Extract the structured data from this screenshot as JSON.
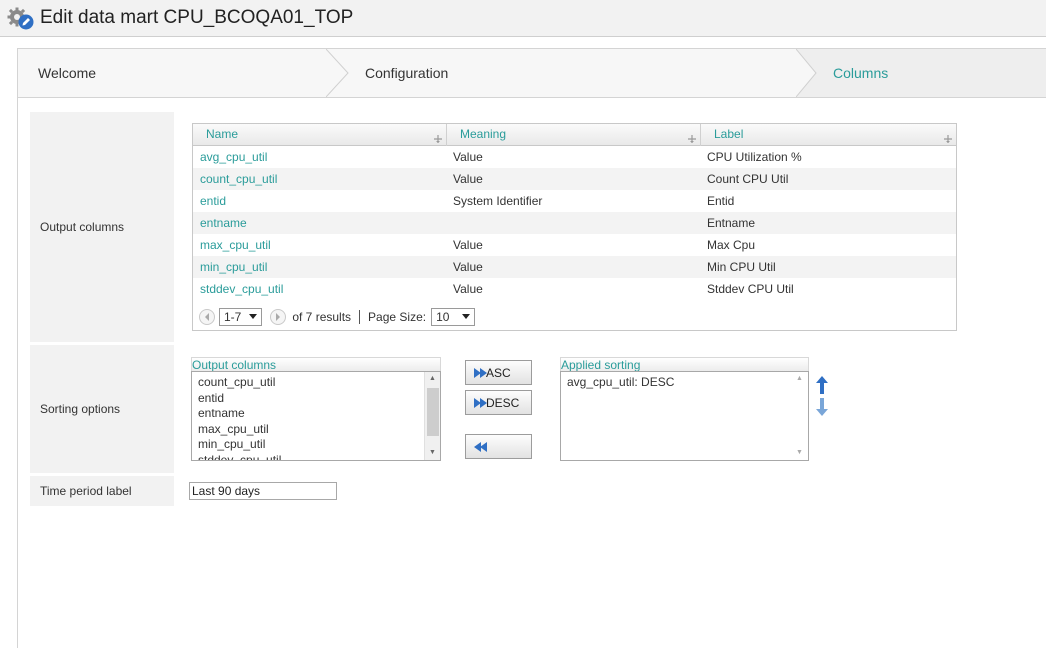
{
  "window": {
    "title": "Edit data mart CPU_BCOQA01_TOP"
  },
  "wizard": {
    "steps": [
      {
        "label": "Welcome"
      },
      {
        "label": "Configuration"
      },
      {
        "label": "Columns"
      }
    ],
    "active_step": "Columns",
    "accent_color": "#2a9c9a"
  },
  "sections": {
    "output_columns_label": "Output columns",
    "sorting_options_label": "Sorting options",
    "time_period_label": "Time period label"
  },
  "grid": {
    "headers": [
      "Name",
      "Meaning",
      "Label"
    ],
    "rows": [
      {
        "name": "avg_cpu_util",
        "meaning": "Value",
        "label": "CPU Utilization %"
      },
      {
        "name": "count_cpu_util",
        "meaning": "Value",
        "label": "Count CPU Util"
      },
      {
        "name": "entid",
        "meaning": "System Identifier",
        "label": "Entid"
      },
      {
        "name": "entname",
        "meaning": "",
        "label": "Entname"
      },
      {
        "name": "max_cpu_util",
        "meaning": "Value",
        "label": "Max Cpu"
      },
      {
        "name": "min_cpu_util",
        "meaning": "Value",
        "label": "Min CPU Util"
      },
      {
        "name": "stddev_cpu_util",
        "meaning": "Value",
        "label": "Stddev CPU Util"
      }
    ],
    "pager": {
      "range": "1-7",
      "results_text": "of 7 results",
      "page_size_label": "Page Size:",
      "page_size": "10"
    }
  },
  "sorting": {
    "available_caption": "Output columns",
    "available_items": [
      "count_cpu_util",
      "entid",
      "entname",
      "max_cpu_util",
      "min_cpu_util",
      "stddev_cpu_util"
    ],
    "asc_label": "ASC",
    "desc_label": "DESC",
    "applied_caption": "Applied sorting",
    "applied_items": [
      "avg_cpu_util: DESC"
    ]
  },
  "time_period": {
    "value": "Last 90 days"
  }
}
